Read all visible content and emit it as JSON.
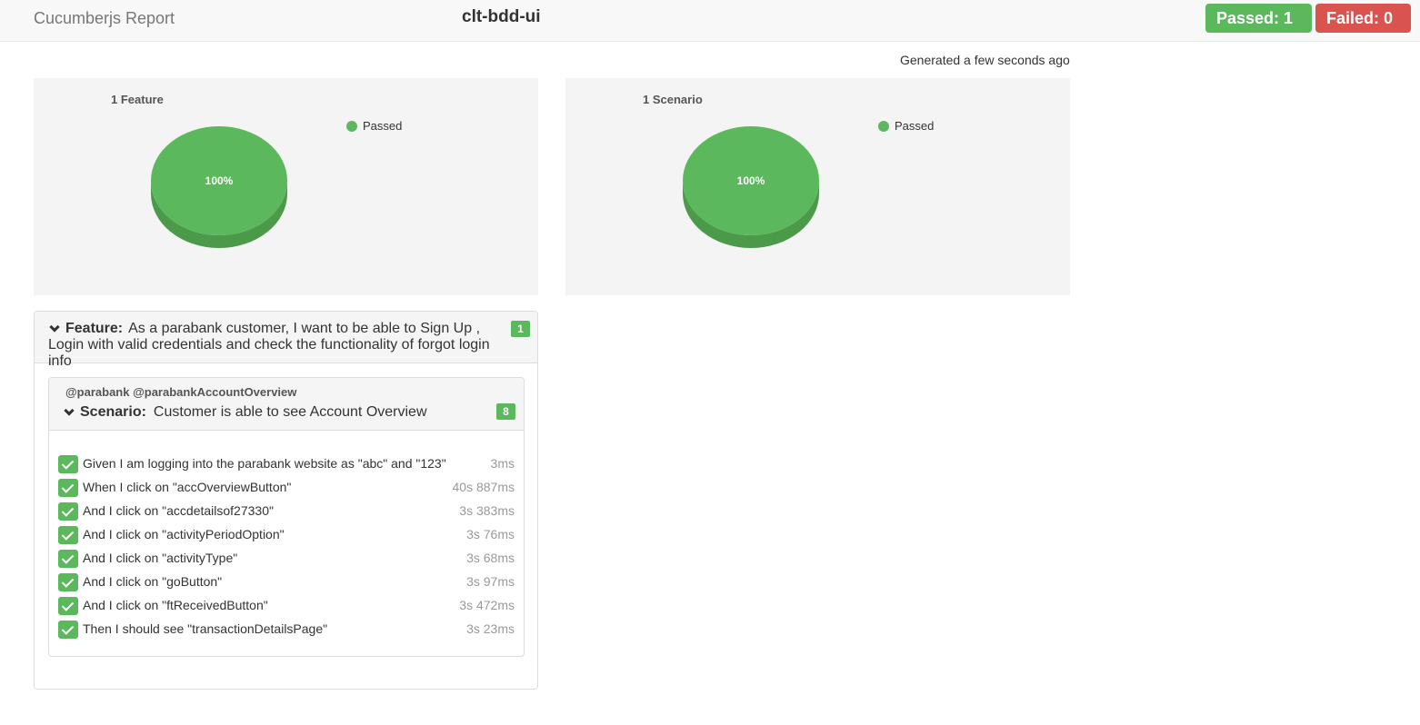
{
  "header": {
    "brand": "Cucumberjs Report",
    "project": "clt-bdd-ui",
    "passed_label": "Passed: 1",
    "failed_label": "Failed: 0"
  },
  "generated": "Generated a few seconds ago",
  "charts": [
    {
      "title": "1 Feature",
      "legend": "Passed",
      "pie_label": "100%"
    },
    {
      "title": "1 Scenario",
      "legend": "Passed",
      "pie_label": "100%"
    }
  ],
  "chart_data": [
    {
      "type": "pie",
      "title": "1 Feature",
      "categories": [
        "Passed"
      ],
      "values": [
        100
      ],
      "colors": [
        "#5cb85c"
      ],
      "legend": "top-right"
    },
    {
      "type": "pie",
      "title": "1 Scenario",
      "categories": [
        "Passed"
      ],
      "values": [
        100
      ],
      "colors": [
        "#5cb85c"
      ],
      "legend": "top-right"
    }
  ],
  "feature": {
    "keyword": "Feature:",
    "name_line1": "As a parabank customer, I want to be able to Sign Up ,",
    "name_line2": "Login with valid credentials and check the functionality of forgot login info",
    "count": "1"
  },
  "scenario": {
    "tags": "@parabank @parabankAccountOverview",
    "keyword": "Scenario:",
    "name": "Customer is able to see Account Overview",
    "count": "8",
    "steps": [
      {
        "text": "Given I am logging into the parabank website as \"abc\" and \"123\"",
        "duration": "3ms"
      },
      {
        "text": "When I click on \"accOverviewButton\"",
        "duration": "40s 887ms"
      },
      {
        "text": "And I click on \"accdetailsof27330\"",
        "duration": "3s 383ms"
      },
      {
        "text": "And I click on \"activityPeriodOption\"",
        "duration": "3s 76ms"
      },
      {
        "text": "And I click on \"activityType\"",
        "duration": "3s 68ms"
      },
      {
        "text": "And I click on \"goButton\"",
        "duration": "3s 97ms"
      },
      {
        "text": "And I click on \"ftReceivedButton\"",
        "duration": "3s 472ms"
      },
      {
        "text": "Then I should see \"transactionDetailsPage\"",
        "duration": "3s 23ms"
      }
    ]
  },
  "colors": {
    "passed": "#5cb85c",
    "failed": "#d9534f",
    "pie_side": "#4a9a4a"
  }
}
